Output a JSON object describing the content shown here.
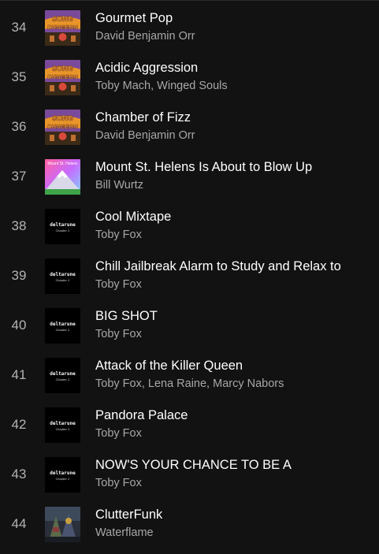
{
  "tracks": [
    {
      "number": "34",
      "title": "Gourmet Pop",
      "artist": "David Benjamin Orr",
      "art": "song-dungeon-cover"
    },
    {
      "number": "35",
      "title": "Acidic Aggression",
      "artist": "Toby Mach, Winged Souls",
      "art": "song-dungeon-cover"
    },
    {
      "number": "36",
      "title": "Chamber of Fizz",
      "artist": "David Benjamin Orr",
      "art": "song-dungeon-cover"
    },
    {
      "number": "37",
      "title": "Mount St. Helens Is About to Blow Up",
      "artist": "Bill Wurtz",
      "art": "mount-st-helens-cover"
    },
    {
      "number": "38",
      "title": "Cool Mixtape",
      "artist": "Toby Fox",
      "art": "deltarune-cover"
    },
    {
      "number": "39",
      "title": "Chill Jailbreak Alarm to Study and Relax to",
      "artist": "Toby Fox",
      "art": "deltarune-cover"
    },
    {
      "number": "40",
      "title": "BIG SHOT",
      "artist": "Toby Fox",
      "art": "deltarune-cover"
    },
    {
      "number": "41",
      "title": "Attack of the Killer Queen",
      "artist": "Toby Fox, Lena Raine, Marcy Nabors",
      "art": "deltarune-cover"
    },
    {
      "number": "42",
      "title": "Pandora Palace",
      "artist": "Toby Fox",
      "art": "deltarune-cover"
    },
    {
      "number": "43",
      "title": "NOW'S YOUR CHANCE TO BE A",
      "artist": "Toby Fox",
      "art": "deltarune-cover"
    },
    {
      "number": "44",
      "title": "ClutterFunk",
      "artist": "Waterflame",
      "art": "clutterfunk-cover"
    }
  ],
  "art_text": {
    "song_dungeon": "SONG DUNGEON",
    "mount_st_helens": "Mount St. Helens",
    "deltarune": "deltarune",
    "chapter": "Chapter 2"
  },
  "colors": {
    "background": "#121212",
    "title_text": "#ffffff",
    "secondary_text": "#a7a7a7"
  }
}
